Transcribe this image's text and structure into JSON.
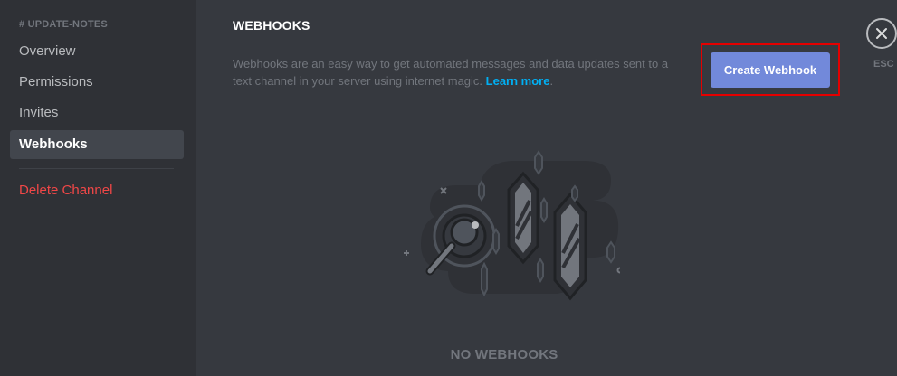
{
  "sidebar": {
    "header": "# UPDATE-NOTES",
    "items": [
      {
        "label": "Overview"
      },
      {
        "label": "Permissions"
      },
      {
        "label": "Invites"
      },
      {
        "label": "Webhooks",
        "selected": true
      }
    ],
    "delete_label": "Delete Channel"
  },
  "main": {
    "title": "WEBHOOKS",
    "description": "Webhooks are an easy way to get automated messages and data updates sent to a text channel in your server using internet magic.",
    "learn_more": "Learn more",
    "description_end": ".",
    "create_button": "Create Webhook",
    "empty_state": "NO WEBHOOKS"
  },
  "close": {
    "icon": "close-icon",
    "label": "ESC"
  },
  "colors": {
    "accent": "#7289da",
    "danger": "#f04747",
    "link": "#00b0f4",
    "highlight": "#e50000"
  }
}
